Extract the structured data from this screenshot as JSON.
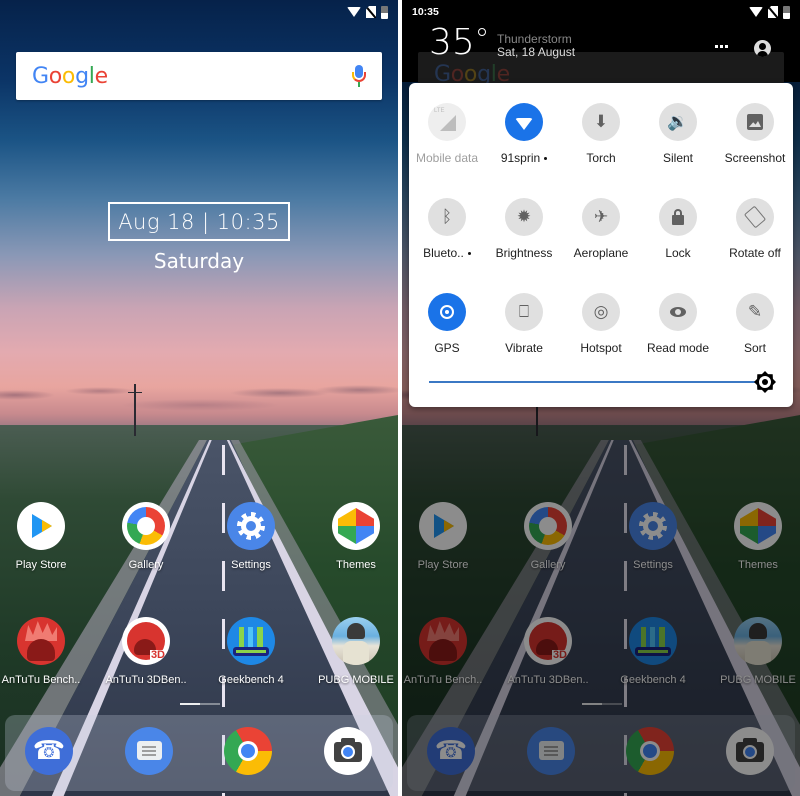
{
  "home": {
    "status_bar": {
      "time": "",
      "icons": [
        "wifi-icon",
        "no-sim-icon",
        "battery-icon"
      ]
    },
    "search": {
      "logo_letters": [
        "G",
        "o",
        "o",
        "g",
        "l",
        "e"
      ],
      "mic_icon": "mic-icon"
    },
    "clock": {
      "date_time": "Aug 18 | 10:35",
      "day": "Saturday"
    },
    "apps": [
      {
        "label": "Play Store",
        "icon": "play-store-icon"
      },
      {
        "label": "Gallery",
        "icon": "gallery-icon"
      },
      {
        "label": "Settings",
        "icon": "settings-icon"
      },
      {
        "label": "Themes",
        "icon": "themes-icon"
      },
      {
        "label": "AnTuTu Bench..",
        "icon": "antutu-icon"
      },
      {
        "label": "AnTuTu 3DBen..",
        "icon": "antutu-3d-icon"
      },
      {
        "label": "Geekbench 4",
        "icon": "geekbench-icon"
      },
      {
        "label": "PUBG MOBILE",
        "icon": "pubg-icon"
      }
    ],
    "dock": [
      {
        "name": "Phone",
        "icon": "phone-icon"
      },
      {
        "name": "Messages",
        "icon": "messages-icon"
      },
      {
        "name": "Chrome",
        "icon": "chrome-icon"
      },
      {
        "name": "Camera",
        "icon": "camera-icon"
      }
    ],
    "antutu3d_tag": "3D"
  },
  "shade": {
    "status_bar": {
      "time": "10:35"
    },
    "header": {
      "temperature": "35",
      "weather": "Thunderstorm",
      "date": "Sat, 18 August"
    },
    "tiles": [
      {
        "label": "Mobile data",
        "icon": "mobile-data-icon",
        "state": "disabled"
      },
      {
        "label": "91sprin",
        "icon": "wifi-icon",
        "state": "active",
        "dot": true
      },
      {
        "label": "Torch",
        "icon": "torch-icon",
        "state": "off",
        "glyph": "⬇"
      },
      {
        "label": "Silent",
        "icon": "volume-icon",
        "state": "off",
        "glyph": "🔉"
      },
      {
        "label": "Screenshot",
        "icon": "screenshot-icon",
        "state": "off"
      },
      {
        "label": "Blueto..",
        "icon": "bluetooth-icon",
        "state": "off",
        "glyph": "ᛒ",
        "dot": true
      },
      {
        "label": "Brightness",
        "icon": "auto-brightness-icon",
        "state": "off",
        "glyph": "✹"
      },
      {
        "label": "Aeroplane",
        "icon": "airplane-icon",
        "state": "off",
        "glyph": "✈"
      },
      {
        "label": "Lock",
        "icon": "lock-icon",
        "state": "off"
      },
      {
        "label": "Rotate off",
        "icon": "rotate-icon",
        "state": "off"
      },
      {
        "label": "GPS",
        "icon": "gps-icon",
        "state": "active"
      },
      {
        "label": "Vibrate",
        "icon": "vibrate-icon",
        "state": "off",
        "glyph": "⎕"
      },
      {
        "label": "Hotspot",
        "icon": "hotspot-icon",
        "state": "off",
        "glyph": "◎"
      },
      {
        "label": "Read mode",
        "icon": "eye-icon",
        "state": "off"
      },
      {
        "label": "Sort",
        "icon": "edit-icon",
        "state": "off",
        "glyph": "✎"
      }
    ],
    "brightness": {
      "level": 1.0
    }
  }
}
